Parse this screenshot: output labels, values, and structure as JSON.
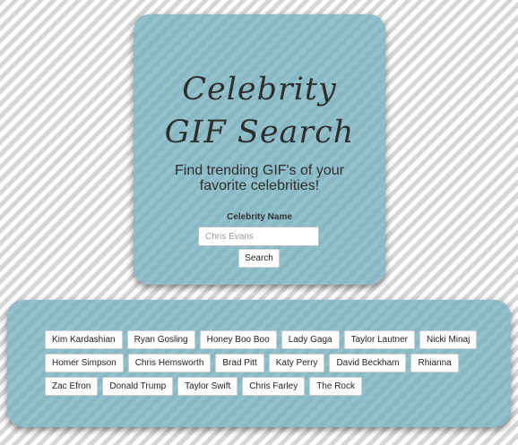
{
  "search_card": {
    "title": "Celebrity GIF Search",
    "subtitle": "Find trending GIF's of your favorite celebrities!",
    "field_label": "Celebrity Name",
    "input_value": "",
    "input_placeholder": "Chris Evans",
    "search_label": "Search"
  },
  "celebrity_buttons": [
    "Kim Kardashian",
    "Ryan Gosling",
    "Honey Boo Boo",
    "Lady Gaga",
    "Taylor Lautner",
    "Nicki Minaj",
    "Homer Simpson",
    "Chris Hemsworth",
    "Brad Pitt",
    "Katy Perry",
    "David Beckham",
    "Rhianna",
    "Zac Efron",
    "Donald Trump",
    "Taylor Swift",
    "Chris Farley",
    "The Rock"
  ],
  "colors": {
    "panel_teal": "#8bbcc9",
    "stripe_gray": "#d6d6d6",
    "background_white": "#ffffff",
    "text_dark": "#2e2e2e"
  }
}
